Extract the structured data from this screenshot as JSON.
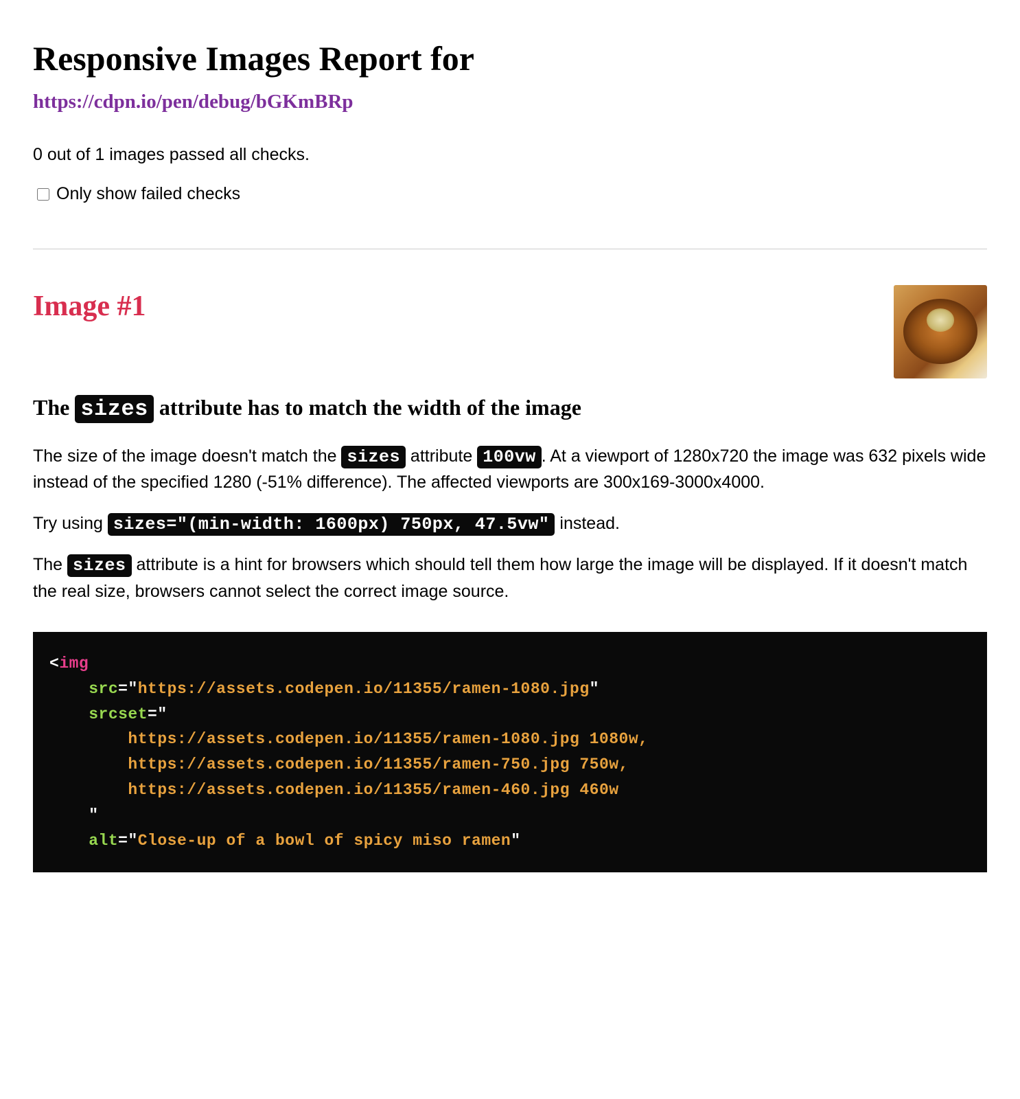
{
  "header": {
    "title": "Responsive Images Report for",
    "url": "https://cdpn.io/pen/debug/bGKmBRp"
  },
  "summary": {
    "text": "0 out of 1 images passed all checks.",
    "checkbox_label": "Only show failed checks"
  },
  "image_section": {
    "heading": "Image #1",
    "subheading_pre": "The ",
    "subheading_code": "sizes",
    "subheading_post": " attribute has to match the width of the image",
    "para1_a": "The size of the image doesn't match the ",
    "para1_code1": "sizes",
    "para1_b": " attribute ",
    "para1_code2": "100vw",
    "para1_c": ". At a viewport of 1280x720 the image was 632 pixels wide instead of the specified 1280 (-51% difference). The affected viewports are 300x169-3000x4000.",
    "para2_a": "Try using ",
    "para2_code": "sizes=\"(min-width: 1600px) 750px, 47.5vw\"",
    "para2_b": " instead.",
    "para3_a": "The ",
    "para3_code": "sizes",
    "para3_b": " attribute is a hint for browsers which should tell them how large the image will be displayed. If it doesn't match the real size, browsers cannot select the correct image source."
  },
  "code": {
    "tag": "img",
    "src_attr": "src",
    "src_val": "https://assets.codepen.io/11355/ramen-1080.jpg",
    "srcset_attr": "srcset",
    "srcset_line1_url": "https://assets.codepen.io/11355/ramen-1080.jpg",
    "srcset_line1_w": " 1080w,",
    "srcset_line2_url": "https://assets.codepen.io/11355/ramen-750.jpg",
    "srcset_line2_w": " 750w,",
    "srcset_line3_url": "https://assets.codepen.io/11355/ramen-460.jpg",
    "srcset_line3_w": " 460w",
    "alt_attr": "alt",
    "alt_val": "Close-up of a bowl of spicy miso ramen"
  }
}
